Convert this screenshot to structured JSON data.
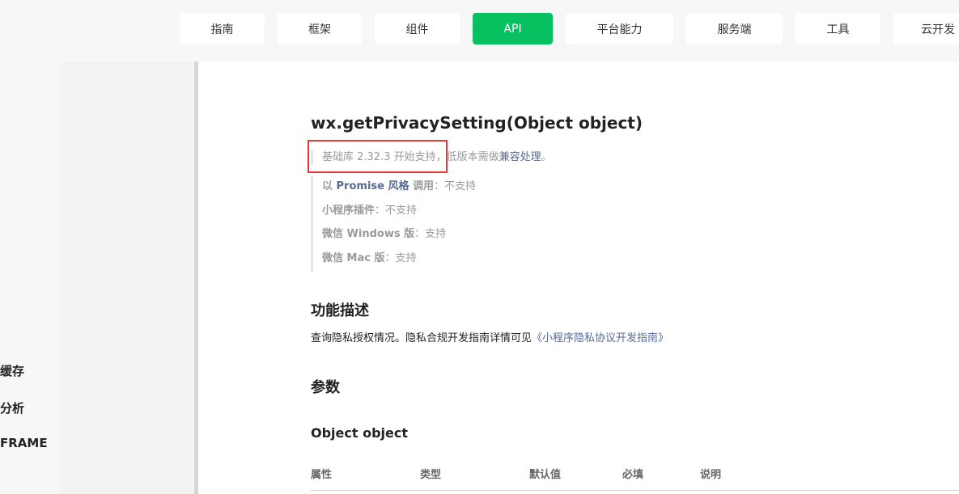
{
  "topnav": {
    "items": [
      {
        "label": "指南"
      },
      {
        "label": "框架"
      },
      {
        "label": "组件"
      },
      {
        "label": "API"
      },
      {
        "label": "平台能力"
      },
      {
        "label": "服务端"
      },
      {
        "label": "工具"
      },
      {
        "label": "云开发"
      }
    ],
    "active": "API",
    "accent_color": "#07c160"
  },
  "sidebar": {
    "items": [
      {
        "label": "缓存"
      },
      {
        "label": "分析"
      },
      {
        "label": "FRAME"
      }
    ]
  },
  "content": {
    "title": "wx.getPrivacySetting(Object object)",
    "support": {
      "base_text": "基础库 2.32.3 开始支持，",
      "low_version_text": "低版本需做",
      "compat_link": "兼容处理",
      "end": "。",
      "highlight_color": "#e53935"
    },
    "support_list": [
      {
        "prefix": "以 ",
        "link": "Promise 风格",
        "suffix": " 调用",
        "value": "：不支持"
      },
      {
        "key": "小程序插件",
        "value": "：不支持"
      },
      {
        "key": "微信 Windows 版",
        "value": "：支持"
      },
      {
        "key": "微信 Mac 版",
        "value": "：支持"
      }
    ],
    "section_function": "功能描述",
    "description": "查询隐私授权情况。隐私合规开发指南详情可见",
    "description_link": "《小程序隐私协议开发指南》",
    "section_params": "参数",
    "param_heading": "Object object",
    "table_headers": [
      "属性",
      "类型",
      "默认值",
      "必填",
      "说明"
    ],
    "link_color": "#576b95"
  }
}
